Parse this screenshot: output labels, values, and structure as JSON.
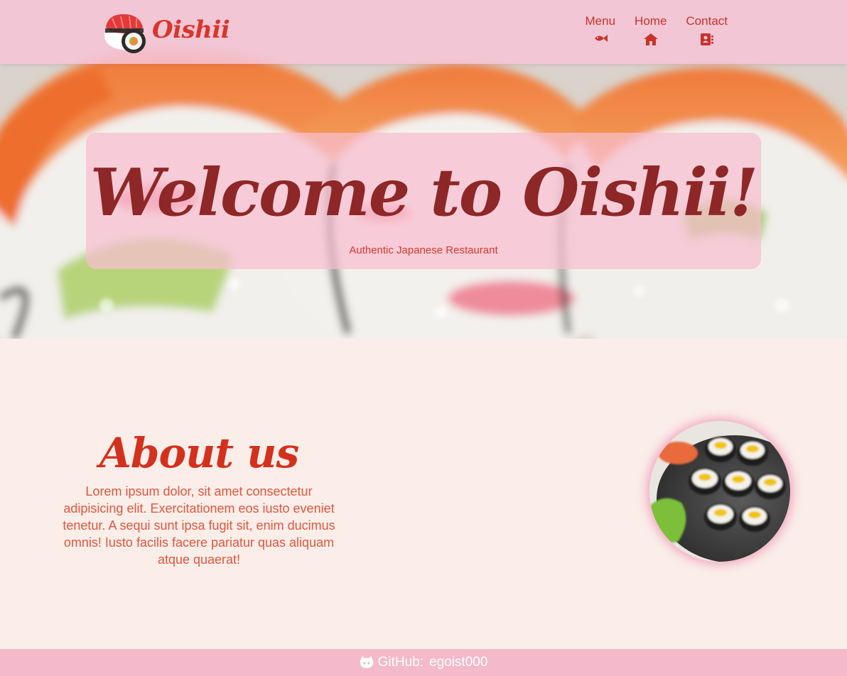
{
  "header": {
    "brand": "Oishii",
    "logo_icon": "sushi-logo-icon",
    "nav": [
      {
        "label": "Menu",
        "icon": "fish-icon"
      },
      {
        "label": "Home",
        "icon": "house-icon"
      },
      {
        "label": "Contact",
        "icon": "address-book-icon"
      }
    ]
  },
  "hero": {
    "title": "Welcome to Oishii!",
    "subtitle": "Authentic Japanese Restaurant",
    "background": "sushi-rolls-photo"
  },
  "about": {
    "title": "About us",
    "text": "Lorem ipsum dolor, sit amet consectetur adipisicing elit. Exercitationem eos iusto eveniet tenetur. A sequi sunt ipsa fugit sit, enim ducimus omnis! Iusto facilis facere pariatur quas aliquam atque quaerat!",
    "photo": "maki-rolls-photo"
  },
  "footer": {
    "icon": "github-icon",
    "label": "GitHub:",
    "username": "egoist000"
  },
  "colors": {
    "accent": "#d9352b",
    "header_bg": "#f5c4d6",
    "page_bg": "#fbeee9",
    "footer_bg": "#f4b9cb",
    "title_dark": "#8e2727"
  }
}
